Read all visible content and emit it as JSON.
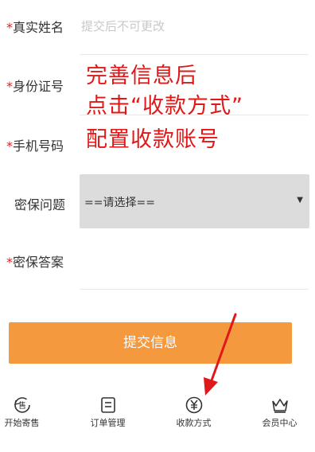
{
  "form": {
    "name": {
      "required": "*",
      "label": "真实姓名",
      "placeholder": "提交后不可更改"
    },
    "id_number": {
      "required": "*",
      "label": "身份证号"
    },
    "phone": {
      "required": "*",
      "label": "手机号码"
    },
    "security_question": {
      "label": "密保问题",
      "selected": "==请选择=="
    },
    "security_answer": {
      "required": "*",
      "label": "密保答案"
    },
    "submit_label": "提交信息"
  },
  "annotation": {
    "line1": "完善信息后",
    "line2": "点击“收款方式”",
    "line3": "配置收款账号",
    "color": "#e01818"
  },
  "tabbar": {
    "items": [
      {
        "label": "开始寄售",
        "icon": "sell-icon"
      },
      {
        "label": "订单管理",
        "icon": "order-list-icon"
      },
      {
        "label": "收款方式",
        "icon": "yuan-icon"
      },
      {
        "label": "会员中心",
        "icon": "crown-icon"
      }
    ]
  },
  "colors": {
    "accent": "#f4993e",
    "required": "#e02020"
  }
}
